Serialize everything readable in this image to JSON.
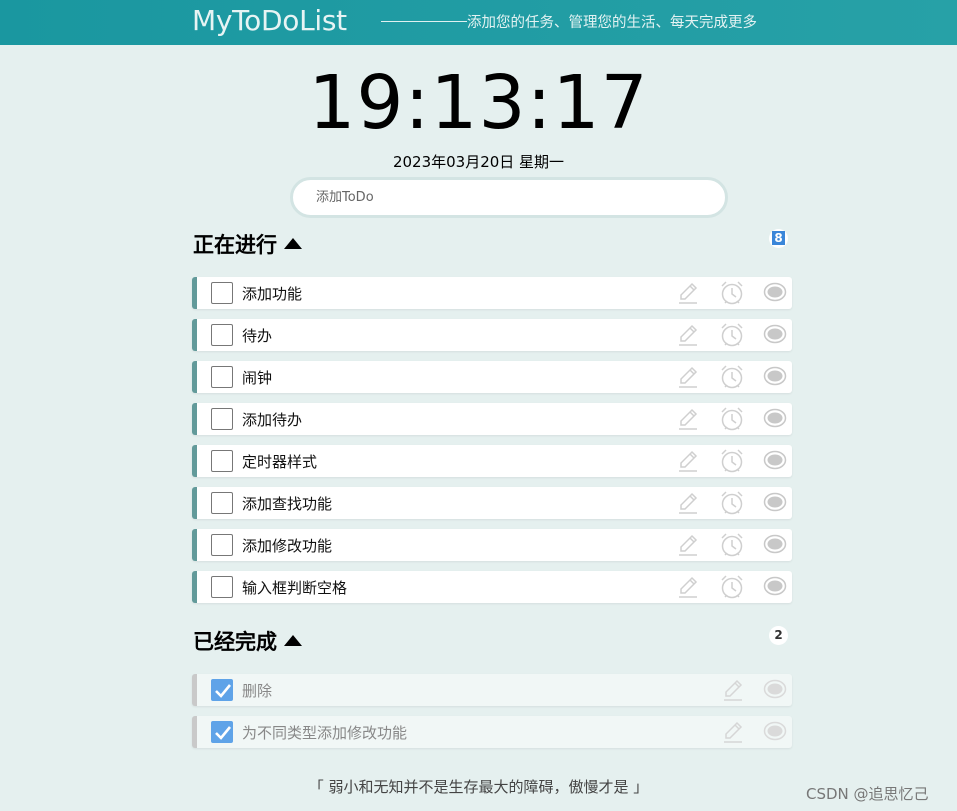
{
  "header": {
    "app_title": "MyToDoList",
    "slogan": "添加您的任务、管理您的生活、每天完成更多"
  },
  "clock": {
    "time": "19:13:17",
    "date": "2023年03月20日 星期一"
  },
  "add_todo": {
    "placeholder": "添加ToDo",
    "value": ""
  },
  "in_progress": {
    "title": "正在进行",
    "count": "8",
    "items": [
      {
        "label": "添加功能",
        "checked": false
      },
      {
        "label": "待办",
        "checked": false
      },
      {
        "label": "闹钟",
        "checked": false
      },
      {
        "label": "添加待办",
        "checked": false
      },
      {
        "label": "定时器样式",
        "checked": false
      },
      {
        "label": "添加查找功能",
        "checked": false
      },
      {
        "label": "添加修改功能",
        "checked": false
      },
      {
        "label": "输入框判断空格",
        "checked": false
      }
    ]
  },
  "completed": {
    "title": "已经完成",
    "count": "2",
    "items": [
      {
        "label": "删除",
        "checked": true
      },
      {
        "label": "为不同类型添加修改功能",
        "checked": true
      }
    ]
  },
  "footer": {
    "quote": "「  弱小和无知并不是生存最大的障碍，傲慢才是  」",
    "watermark": "CSDN @追思忆己"
  },
  "colors": {
    "header": "#1a97a0",
    "background": "#e5f0ef",
    "active_accent": "#629a9a",
    "done_accent": "#c9c9c9",
    "checkbox_checked": "#5fa3e8"
  },
  "icons": {
    "edit": "pencil-icon",
    "alarm": "alarm-clock-icon",
    "toggle": "eye-toggle-icon",
    "collapse": "caret-up-icon"
  }
}
